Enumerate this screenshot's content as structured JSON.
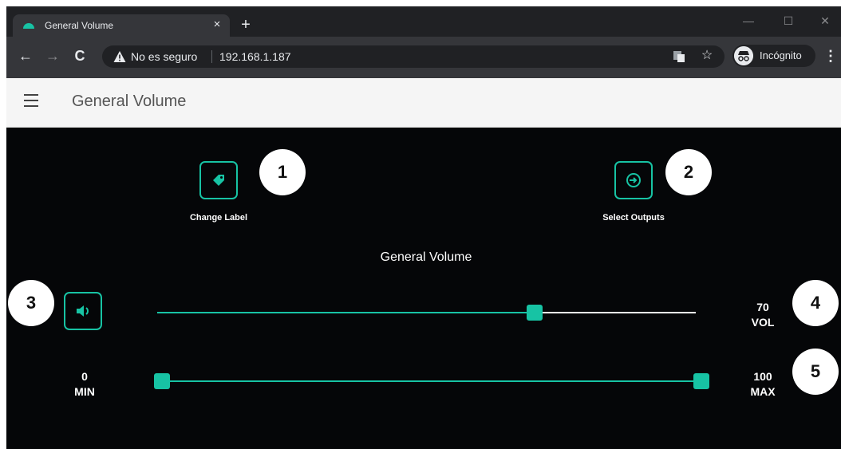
{
  "browser": {
    "tab_title": "General Volume",
    "tab_close": "×",
    "new_tab": "+",
    "security_text": "No es seguro",
    "url": "192.168.1.187",
    "incognito_label": "Incógnito",
    "controls": {
      "minimize": "—",
      "maximize": "☐",
      "close": "✕"
    },
    "nav": {
      "back": "←",
      "forward": "→",
      "reload": "C"
    }
  },
  "app": {
    "title": "General Volume"
  },
  "actions": {
    "change_label": "Change Label",
    "select_outputs": "Select Outputs"
  },
  "volume": {
    "title": "General Volume",
    "value": "70",
    "value_label": "VOL",
    "level_fraction": 0.7
  },
  "range": {
    "min_value": "0",
    "min_label": "MIN",
    "max_value": "100",
    "max_label": "MAX"
  },
  "badges": [
    "1",
    "2",
    "3",
    "4",
    "5"
  ],
  "colors": {
    "accent": "#17c3a4",
    "background": "#050608",
    "header": "#f5f5f5"
  },
  "icons": {
    "change_label": "tag-icon",
    "select_outputs": "sign-in-icon",
    "mute": "speaker-icon"
  }
}
